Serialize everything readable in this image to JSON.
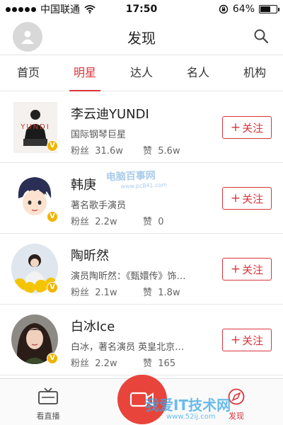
{
  "status_bar": {
    "carrier": "中国联通",
    "time": "17:50",
    "battery": "64%",
    "battery_level": 0.64
  },
  "header": {
    "title": "发现"
  },
  "tabs": [
    {
      "label": "首页"
    },
    {
      "label": "明星",
      "active": true
    },
    {
      "label": "达人"
    },
    {
      "label": "名人"
    },
    {
      "label": "机构"
    }
  ],
  "follow_label": "关注",
  "follow_plus": "+",
  "fans_label": "粉丝",
  "likes_label": "赞",
  "verified_badge": "V",
  "celebrities": [
    {
      "name": "李云迪YUNDI",
      "desc": "国际钢琴巨星",
      "fans": "31.6w",
      "likes": "5.6w",
      "avatar_text": "YUNDI"
    },
    {
      "name": "韩庚",
      "desc": "著名歌手演员",
      "fans": "2.2w",
      "likes": "0"
    },
    {
      "name": "陶昕然",
      "desc": "演员陶昕然：《甄嬛传》饰…",
      "fans": "2.1w",
      "likes": "1.8w"
    },
    {
      "name": "白冰Ice",
      "desc": "白冰，著名演员 英皇北京…",
      "fans": "2.2w",
      "likes": "165"
    }
  ],
  "tab_bar": {
    "live_label": "看直播",
    "discover_label": "发现"
  },
  "watermarks": {
    "top": "电脑百事网",
    "top_url": "www.pc841.com",
    "bottom": "我爱IT技术网",
    "bottom_url": "www.52ij.com"
  },
  "colors": {
    "accent": "#d9343b",
    "record_button": "#e8443c",
    "verified_badge": "#f0b400"
  }
}
